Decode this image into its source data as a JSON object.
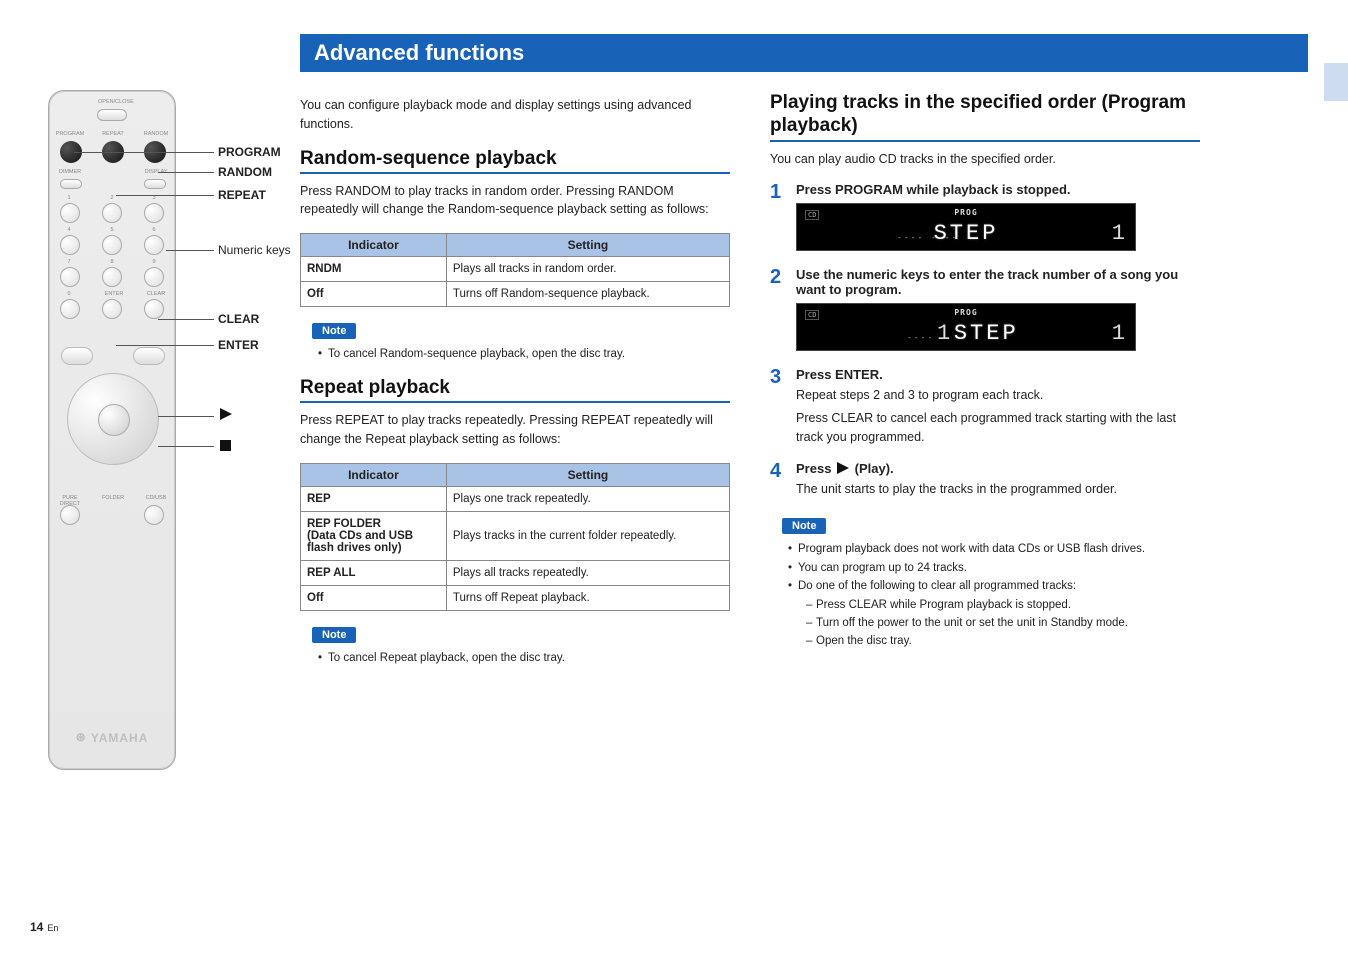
{
  "page": {
    "number": "14",
    "lang": "En"
  },
  "remote": {
    "brand": "YAMAHA",
    "labels": {
      "program": "PROGRAM",
      "random": "RANDOM",
      "repeat": "REPEAT",
      "numeric": "Numeric keys",
      "clear": "CLEAR",
      "enter": "ENTER"
    },
    "btn_text": {
      "open_close": "OPEN/CLOSE",
      "program": "PROGRAM",
      "repeat": "REPEAT",
      "random": "RANDOM",
      "dimmer": "DIMMER",
      "display": "DISPLAY",
      "enter": "ENTER",
      "clear": "CLEAR",
      "pure_direct": "PURE DIRECT",
      "cd_usb": "CD/USB",
      "folder": "FOLDER"
    }
  },
  "title": "Advanced functions",
  "intro": "You can configure playback mode and display settings using advanced functions.",
  "random": {
    "heading": "Random-sequence playback",
    "intro": "Press RANDOM to play tracks in random order. Pressing RANDOM repeatedly will change the Random-sequence playback setting as follows:",
    "th_indicator": "Indicator",
    "th_setting": "Setting",
    "rows": [
      {
        "ind": "RNDM",
        "set": "Plays all tracks in random order."
      },
      {
        "ind": "Off",
        "set": "Turns off Random-sequence playback."
      }
    ],
    "note_label": "Note",
    "note": "To cancel Random-sequence playback, open the disc tray."
  },
  "repeat": {
    "heading": "Repeat playback",
    "intro": "Press REPEAT to play tracks repeatedly. Pressing REPEAT repeatedly will change the Repeat playback setting as follows:",
    "th_indicator": "Indicator",
    "th_setting": "Setting",
    "rows": [
      {
        "ind": "REP",
        "set": "Plays one track repeatedly."
      },
      {
        "ind": "REP FOLDER\n(Data CDs and USB flash drives only)",
        "set": "Plays tracks in the current folder repeatedly."
      },
      {
        "ind": "REP ALL",
        "set": "Plays all tracks repeatedly."
      },
      {
        "ind": "Off",
        "set": "Turns off Repeat playback."
      }
    ],
    "note_label": "Note",
    "note": "To cancel Repeat playback, open the disc tray."
  },
  "program": {
    "heading": "Playing tracks in the specified order (Program playback)",
    "intro": "You can play audio CD tracks in the specified order.",
    "steps": {
      "s1": {
        "num": "1",
        "title": "Press PROGRAM while playback is stopped."
      },
      "s2": {
        "num": "2",
        "title": "Use the numeric keys to enter the track number of a song you want to program."
      },
      "s3": {
        "num": "3",
        "title": "Press ENTER.",
        "t1": "Repeat steps 2 and 3 to program each track.",
        "t2": "Press CLEAR to cancel each programmed track starting with the last track you programmed."
      },
      "s4": {
        "num": "4",
        "title_pre": "Press ",
        "title_post": " (Play).",
        "t1": "The unit starts to play the tracks in the programmed order."
      }
    },
    "disp": {
      "cd": "CD",
      "prog": "PROG",
      "step": "STEP",
      "dashes1": "----  ----",
      "right1": "1",
      "left2_dashes": "----",
      "left2_num": "1",
      "right2": "1"
    },
    "note_label": "Note",
    "notes": {
      "n1": "Program playback does not work with data CDs or USB flash drives.",
      "n2": "You can program up to 24 tracks.",
      "n3": "Do one of the following to clear all programmed tracks:",
      "n3a": "Press CLEAR while Program playback is stopped.",
      "n3b": "Turn off the power to the unit or set the unit in Standby mode.",
      "n3c": "Open the disc tray."
    }
  }
}
